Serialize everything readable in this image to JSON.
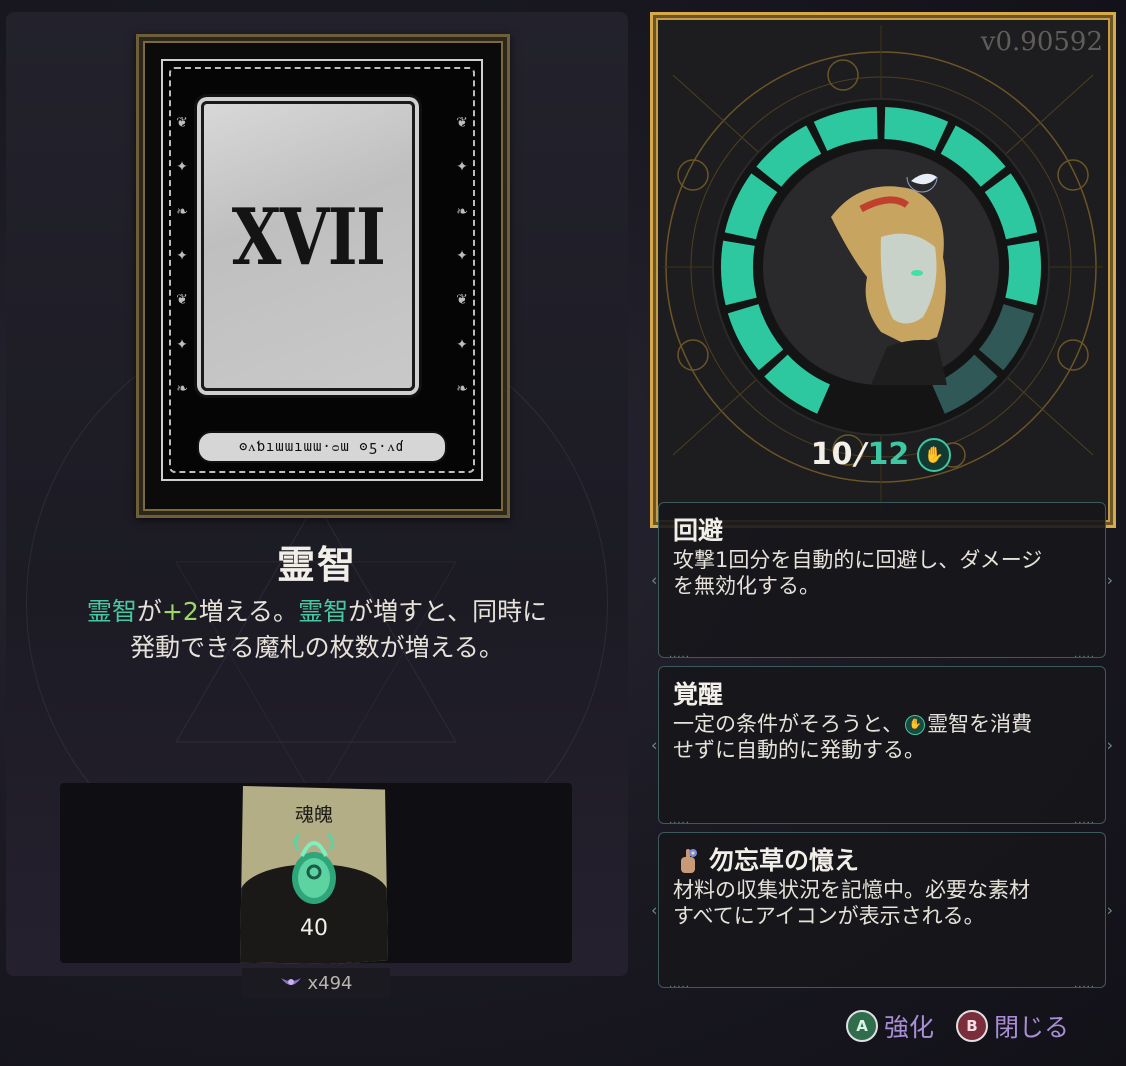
{
  "version": "v0.90592",
  "card": {
    "numeral": "XVII",
    "inscription": "ʘᴧƅıɯɯıɯɯ·ᴑɯ ʘƽ·ᴧɗ"
  },
  "boon": {
    "title": "霊智",
    "desc_kw1": "霊智",
    "desc_text1": "が",
    "desc_num": "+2",
    "desc_text2": "増える。",
    "desc_kw2": "霊智",
    "desc_text3": "が増すと、同時に",
    "desc_line2": "発動できる魔札の枚数が増える。"
  },
  "cost": {
    "label": "魂魄",
    "amount": "40",
    "owned": "x494",
    "icon": "psyche-icon"
  },
  "gauge": {
    "current": "10",
    "slash": "/",
    "max": "12",
    "icon": "grasp-icon",
    "filled_segments": 10,
    "total_segments": 12,
    "fill_color": "#2ec8a0",
    "empty_color": "#2f5856"
  },
  "info_panels": [
    {
      "title": "回避",
      "desc_line1": "攻撃1回分を自動的に回避し、ダメージ",
      "desc_line2": "を無効化する。"
    },
    {
      "title": "覚醒",
      "desc_pre": "一定の条件がそろうと、",
      "desc_kw": "霊智を消費",
      "desc_line2": "せずに自動的に発動する。"
    },
    {
      "title": "勿忘草の憶え",
      "desc_line1": "材料の収集状況を記憶中。必要な素材",
      "desc_line2": "すべてにアイコンが表示される。"
    }
  ],
  "buttons": {
    "upgrade_glyph": "A",
    "upgrade_label": "強化",
    "close_glyph": "B",
    "close_label": "閉じる"
  },
  "colors": {
    "accent_green": "#48c8a0",
    "number_green": "#9fd86a",
    "button_label": "#a98ed6",
    "frame_gold": "#d6a94a"
  }
}
